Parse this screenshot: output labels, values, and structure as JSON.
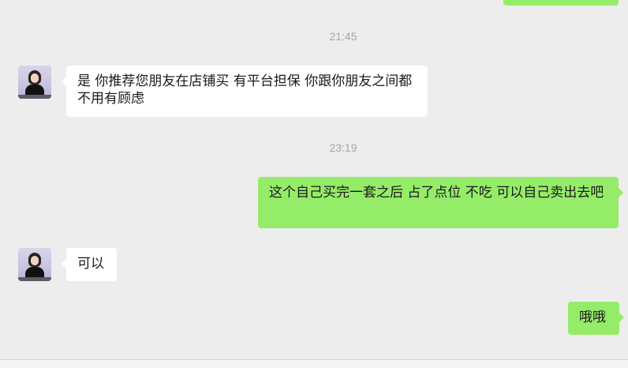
{
  "messages": {
    "time1": "21:45",
    "msg1": "是  你推荐您朋友在店铺买  有平台担保 你跟你朋友之间都不用有顾虑",
    "time2": "23:19",
    "msg2": "这个自己买完一套之后   占了点位   不吃  可以自己卖出去吧",
    "msg3": "可以",
    "msg4": "哦哦"
  },
  "colors": {
    "background": "#ededed",
    "incoming_bubble": "#ffffff",
    "outgoing_bubble": "#95ec69",
    "timestamp_text": "#a6a6a6"
  }
}
